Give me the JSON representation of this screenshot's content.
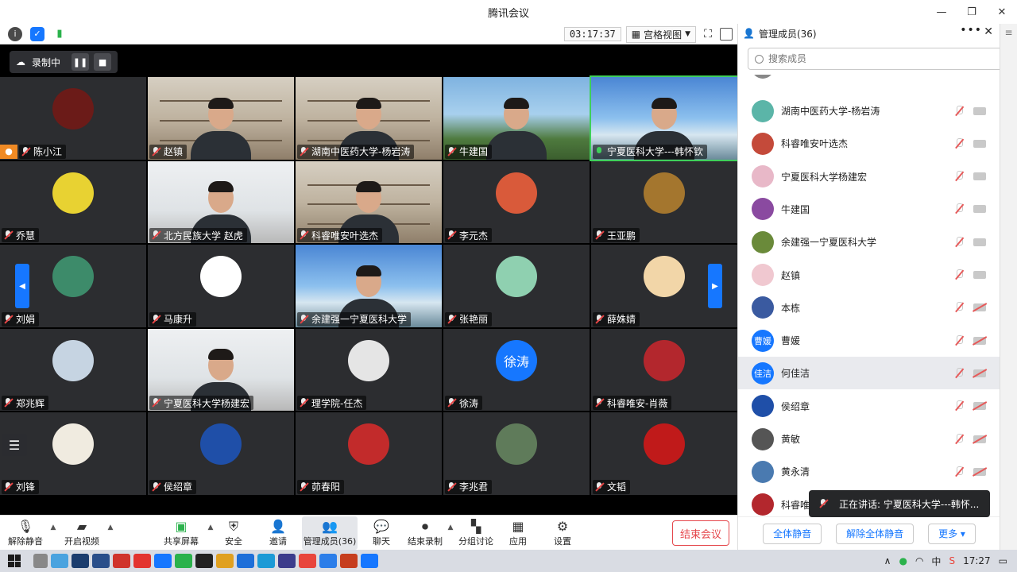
{
  "window": {
    "title": "腾讯会议"
  },
  "toolbar": {
    "timer": "03:17:37",
    "view_label": "宫格视图"
  },
  "recording": {
    "label": "录制中"
  },
  "colors": {
    "accent": "#1677ff",
    "end": "#e5484d",
    "mic_on": "#3fcf5a",
    "host": "#f08a24"
  },
  "tiles": [
    {
      "name": "陈小江",
      "kind": "avatar",
      "bg": "#6b1b18",
      "host": true,
      "mic": "off"
    },
    {
      "name": "赵镇",
      "kind": "video",
      "scene": "shelf",
      "mic": "off"
    },
    {
      "name": "湖南中医药大学-杨岩涛",
      "kind": "video",
      "scene": "shelf",
      "mic": "off"
    },
    {
      "name": "牛建国",
      "kind": "video",
      "scene": "outdoor",
      "mic": "off"
    },
    {
      "name": "宁夏医科大学---韩怀钦",
      "kind": "video",
      "scene": "sky",
      "mic": "on"
    },
    {
      "name": "乔慧",
      "kind": "avatar",
      "bg": "#e8d232",
      "mic": "off"
    },
    {
      "name": "北方民族大学 赵虎",
      "kind": "video",
      "scene": "white",
      "mic": "off"
    },
    {
      "name": "科睿唯安叶选杰",
      "kind": "video",
      "scene": "shelf",
      "mic": "off"
    },
    {
      "name": "李元杰",
      "kind": "avatar",
      "bg": "#d95a3a",
      "mic": "off"
    },
    {
      "name": "王亚鹏",
      "kind": "avatar",
      "bg": "#a4762e",
      "mic": "off"
    },
    {
      "name": "刘娟",
      "kind": "avatar",
      "bg": "#3d8b6a",
      "mic": "off"
    },
    {
      "name": "马康升",
      "kind": "avatar",
      "bg": "#ffffff",
      "mic": "off"
    },
    {
      "name": "余建强一宁夏医科大学",
      "kind": "video",
      "scene": "sky",
      "mic": "off"
    },
    {
      "name": "张艳丽",
      "kind": "avatar",
      "bg": "#8fd0b0",
      "mic": "off"
    },
    {
      "name": "薛姝婧",
      "kind": "avatar",
      "bg": "#f2d6a8",
      "mic": "off"
    },
    {
      "name": "郑兆辉",
      "kind": "avatar",
      "bg": "#c6d4e2",
      "mic": "off"
    },
    {
      "name": "宁夏医科大学杨建宏",
      "kind": "video",
      "scene": "white",
      "mic": "off"
    },
    {
      "name": "理学院-任杰",
      "kind": "avatar",
      "bg": "#e5e5e5",
      "mic": "off"
    },
    {
      "name": "徐涛",
      "kind": "avatar",
      "bg": "#1677ff",
      "text": "徐涛",
      "mic": "off"
    },
    {
      "name": "科睿唯安-肖薇",
      "kind": "avatar",
      "bg": "#b3272d",
      "mic": "off"
    },
    {
      "name": "刘锋",
      "kind": "avatar",
      "bg": "#f0ebe0",
      "mic": "off"
    },
    {
      "name": "侯绍章",
      "kind": "avatar",
      "bg": "#1f4fa8",
      "mic": "off"
    },
    {
      "name": "茆春阳",
      "kind": "avatar",
      "bg": "#c22b2b",
      "mic": "off"
    },
    {
      "name": "李兆君",
      "kind": "avatar",
      "bg": "#5f7b5a",
      "mic": "off"
    },
    {
      "name": "文韬",
      "kind": "avatar",
      "bg": "#c01a1a",
      "mic": "off"
    }
  ],
  "bottombar": {
    "unmute": "解除静音",
    "video": "开启视频",
    "share": "共享屏幕",
    "security": "安全",
    "invite": "邀请",
    "members": "管理成员(36)",
    "chat": "聊天",
    "stop_record": "结束录制",
    "breakout": "分组讨论",
    "apps": "应用",
    "settings": "设置",
    "end": "结束会议"
  },
  "panel": {
    "title": "管理成员(36)",
    "search_placeholder": "搜索成员",
    "members": [
      {
        "name": "湖南中医药大学-杨岩涛",
        "bg": "#5bb5a8",
        "cam": "on"
      },
      {
        "name": "科睿唯安叶选杰",
        "bg": "#c44a3a",
        "cam": "on"
      },
      {
        "name": "宁夏医科大学杨建宏",
        "bg": "#e8b8c8",
        "cam": "on"
      },
      {
        "name": "牛建国",
        "bg": "#8a4aa0",
        "cam": "on"
      },
      {
        "name": "余建强一宁夏医科大学",
        "bg": "#6a8a3a",
        "cam": "on"
      },
      {
        "name": "赵镇",
        "bg": "#f0c8d0",
        "cam": "on"
      },
      {
        "name": "本栋",
        "bg": "#3a5aa0",
        "cam": "off"
      },
      {
        "name": "曹媛",
        "bg": "#1677ff",
        "text": "曹媛",
        "cam": "off"
      },
      {
        "name": "何佳洁",
        "bg": "#1677ff",
        "text": "佳洁",
        "cam": "off",
        "selected": true
      },
      {
        "name": "侯绍章",
        "bg": "#1f4fa8",
        "cam": "off"
      },
      {
        "name": "黄敏",
        "bg": "#555555",
        "cam": "off"
      },
      {
        "name": "黄永清",
        "bg": "#4a7ab0",
        "cam": "off"
      },
      {
        "name": "科睿唯",
        "bg": "#b3272d",
        "cam": "off"
      }
    ],
    "mute_all": "全体静音",
    "unmute_all": "解除全体静音",
    "more": "更多 ▾"
  },
  "toast": {
    "text": "正在讲话: 宁夏医科大学---韩怀..."
  },
  "taskbar": {
    "time": "17:27",
    "ime": "中"
  }
}
